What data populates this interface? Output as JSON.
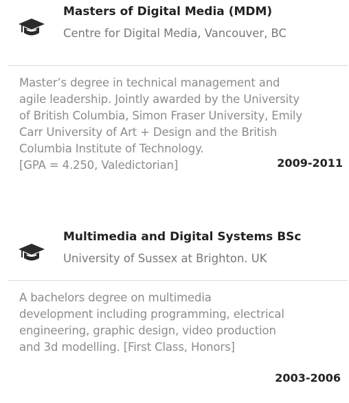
{
  "education": [
    {
      "title": "Masters of Digital Media (MDM)",
      "institution": "Centre for Digital Media, Vancouver, BC",
      "description_lines": [
        "Master’s degree in technical management and",
        "agile leadership. Jointly awarded by the University",
        "of British Columbia, Simon Fraser University, Emily",
        "Carr University of Art + Design and the British",
        "Columbia Institute of Technology.",
        "[GPA = 4.250, Valedictorian]"
      ],
      "dates": "2009-2011",
      "icon": "graduation-cap-icon"
    },
    {
      "title": "Multimedia and Digital Systems BSc",
      "institution": "University of Sussex at Brighton. UK",
      "description_lines": [
        "A bachelors degree on multimedia",
        "development including programming, electrical",
        "engineering, graphic design, video production",
        "and 3d modelling. [First Class, Honors]"
      ],
      "dates": "2003-2006",
      "icon": "graduation-cap-icon"
    }
  ],
  "colors": {
    "title": "#222222",
    "institution": "#787878",
    "description": "#8c8c8c",
    "icon": "#2b2b2b",
    "divider": "#dcdcdc"
  }
}
